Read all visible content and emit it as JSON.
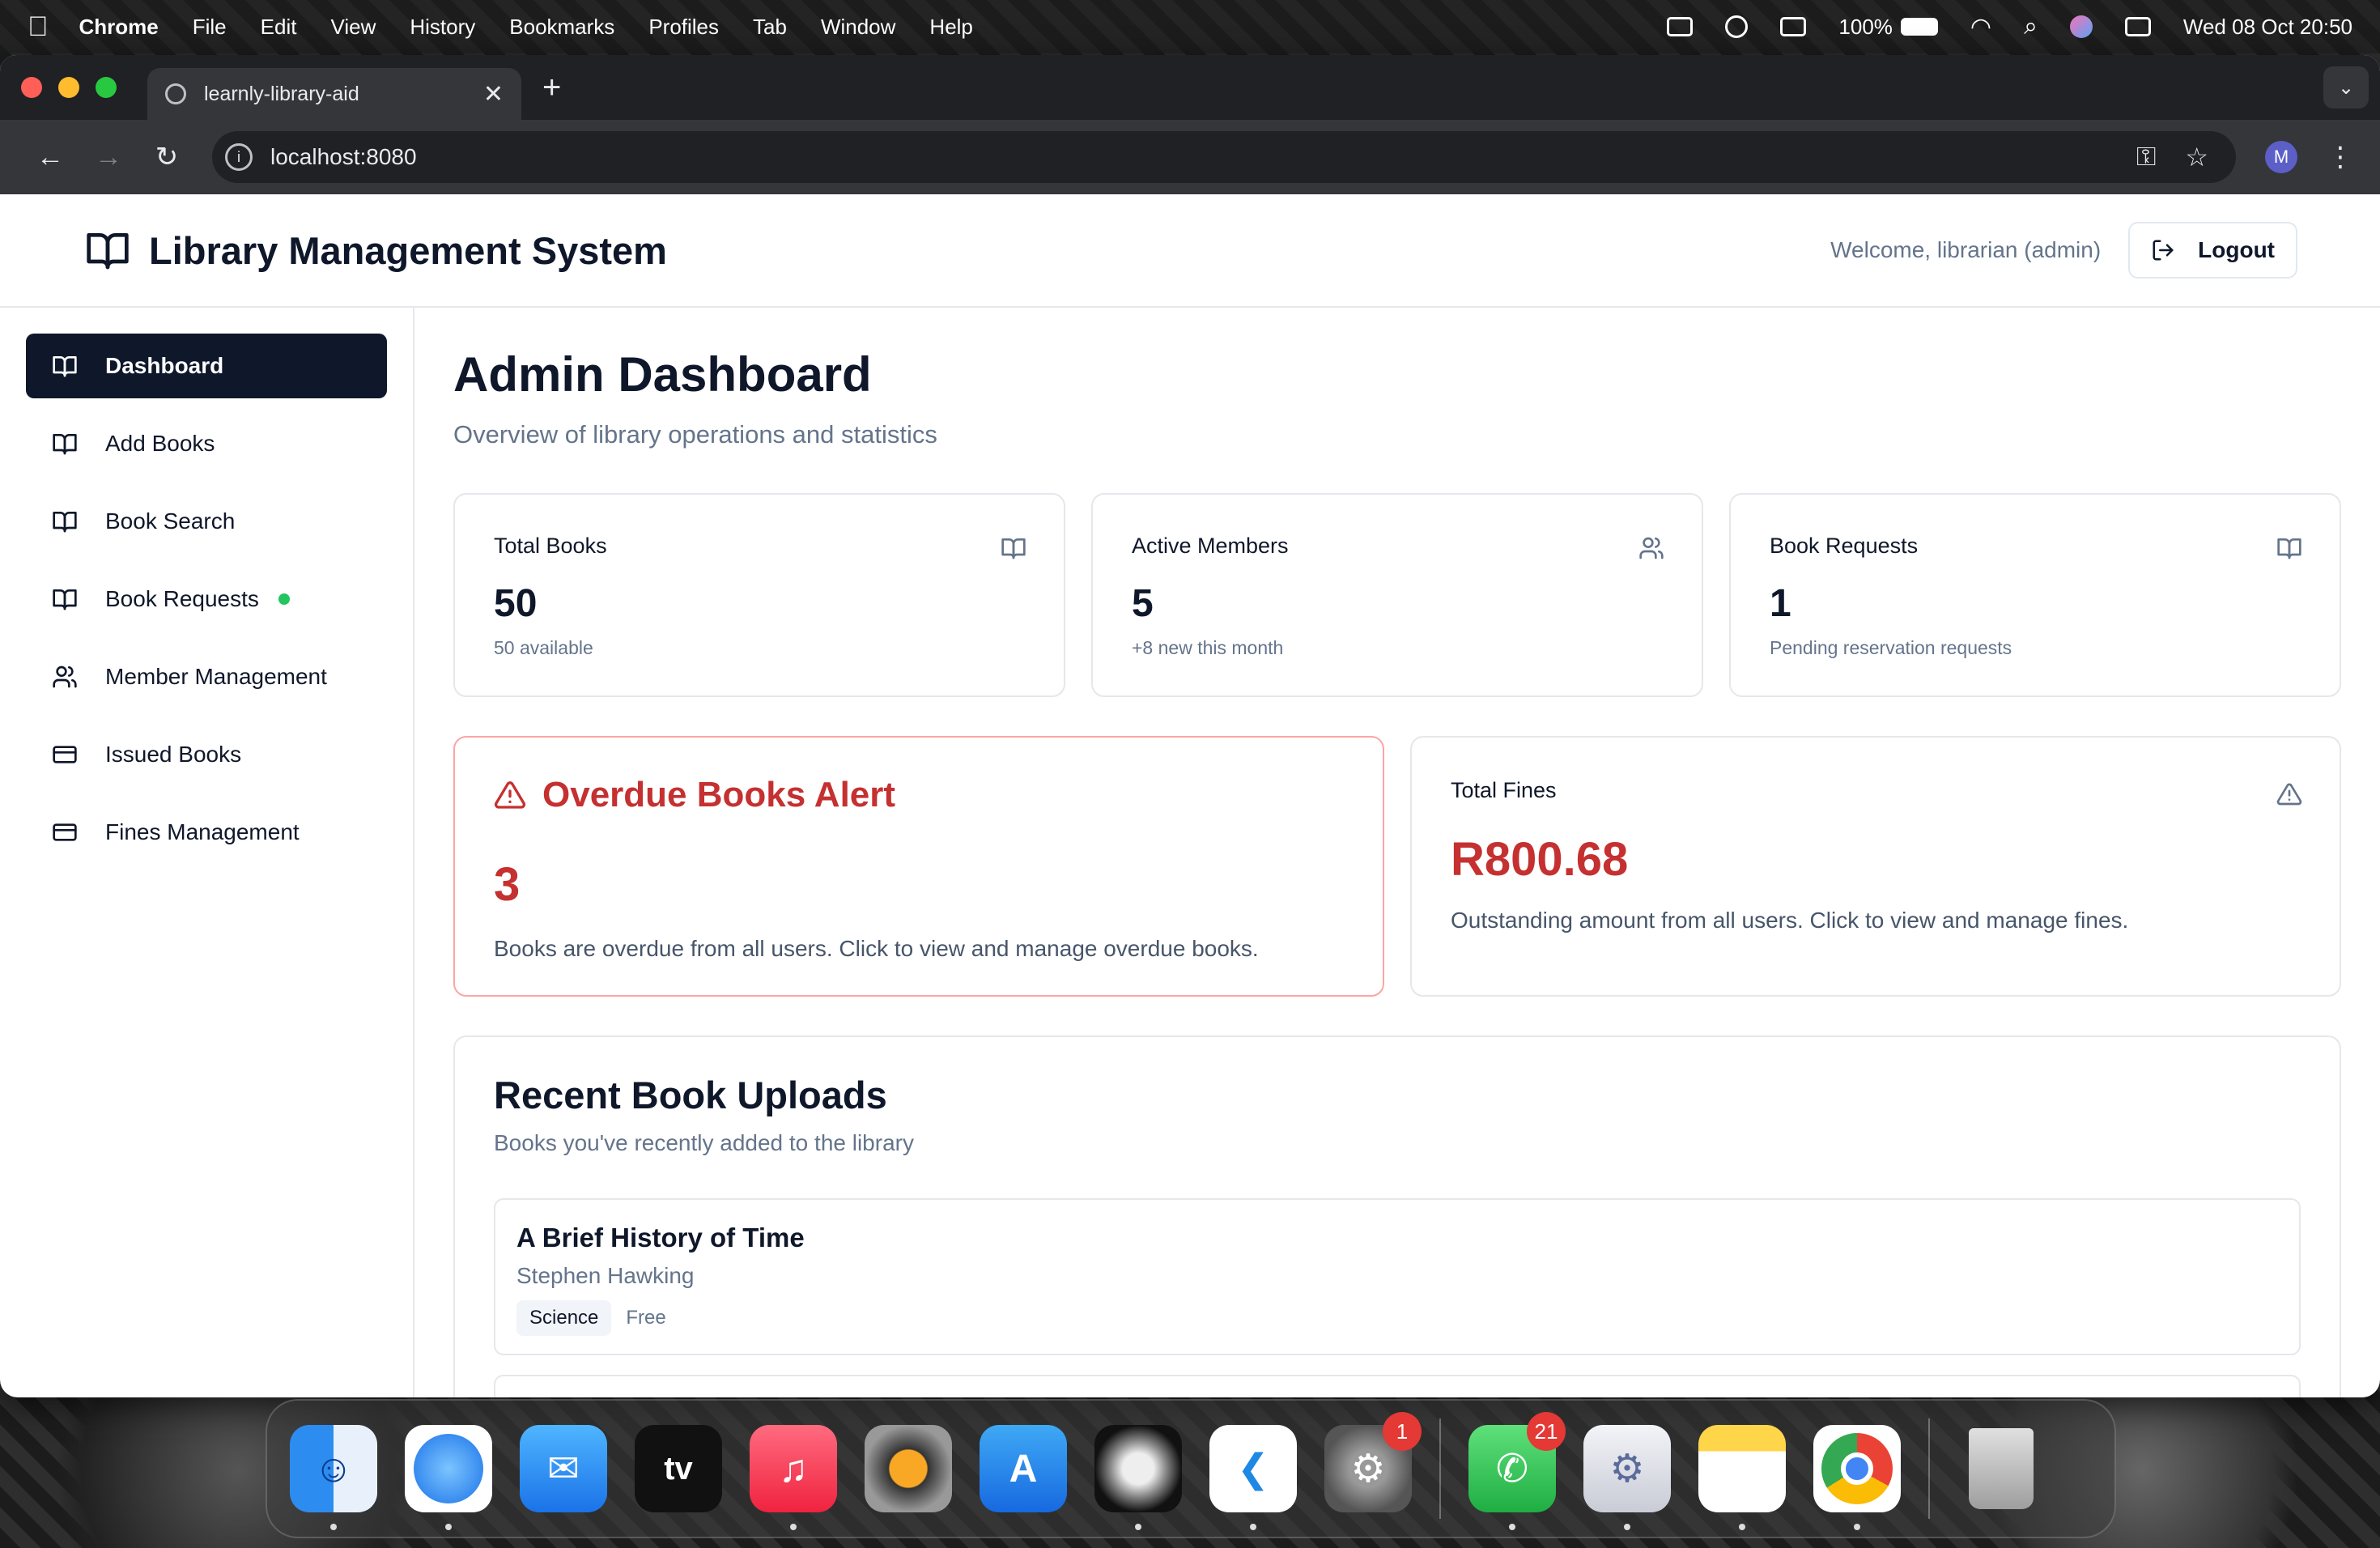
{
  "menubar": {
    "apple": "",
    "app_name": "Chrome",
    "items": [
      "File",
      "Edit",
      "View",
      "History",
      "Bookmarks",
      "Profiles",
      "Tab",
      "Window",
      "Help"
    ],
    "battery": "100%",
    "datetime": "Wed 08 Oct  20:50"
  },
  "browser": {
    "tab_title": "learnly-library-aid",
    "url": "localhost:8080",
    "profile_initial": "M"
  },
  "header": {
    "brand": "Library Management System",
    "welcome": "Welcome, librarian (admin)",
    "logout_label": "Logout"
  },
  "sidebar": {
    "items": [
      {
        "label": "Dashboard",
        "icon": "book-open-icon"
      },
      {
        "label": "Add Books",
        "icon": "book-open-icon"
      },
      {
        "label": "Book Search",
        "icon": "book-open-icon"
      },
      {
        "label": "Book Requests",
        "icon": "book-open-icon"
      },
      {
        "label": "Member Management",
        "icon": "users-icon"
      },
      {
        "label": "Issued Books",
        "icon": "card-icon"
      },
      {
        "label": "Fines Management",
        "icon": "card-icon"
      }
    ]
  },
  "main": {
    "title": "Admin Dashboard",
    "subtitle": "Overview of library operations and statistics",
    "stats": [
      {
        "label": "Total Books",
        "value": "50",
        "note": "50 available",
        "icon": "book-open-icon"
      },
      {
        "label": "Active Members",
        "value": "5",
        "note": "+8 new this month",
        "icon": "users-icon"
      },
      {
        "label": "Book Requests",
        "value": "1",
        "note": "Pending reservation requests",
        "icon": "book-open-icon"
      }
    ],
    "overdue": {
      "title": "Overdue Books Alert",
      "count": "3",
      "description": "Books are overdue from all users. Click to view and manage overdue books."
    },
    "fines": {
      "label": "Total Fines",
      "value": "R800.68",
      "description": "Outstanding amount from all users. Click to view and manage fines."
    },
    "recent": {
      "title": "Recent Book Uploads",
      "subtitle": "Books you've recently added to the library",
      "books": [
        {
          "title": "A Brief History of Time",
          "author": "Stephen Hawking",
          "category": "Science",
          "price": "Free"
        }
      ]
    }
  },
  "dock": {
    "apps": [
      "Finder",
      "Safari",
      "Mail",
      "TV",
      "Music",
      "FL Studio",
      "App Store",
      "Logic",
      "VS Code",
      "System Settings",
      "WhatsApp",
      "Utility",
      "Notes",
      "Chrome",
      "Trash"
    ],
    "badges": {
      "system_settings": "1",
      "whatsapp": "21"
    },
    "tv_label": "tv"
  },
  "colors": {
    "primary": "#0f172a",
    "danger": "#c53030",
    "muted": "#64748b",
    "online_dot": "#22c55e"
  }
}
